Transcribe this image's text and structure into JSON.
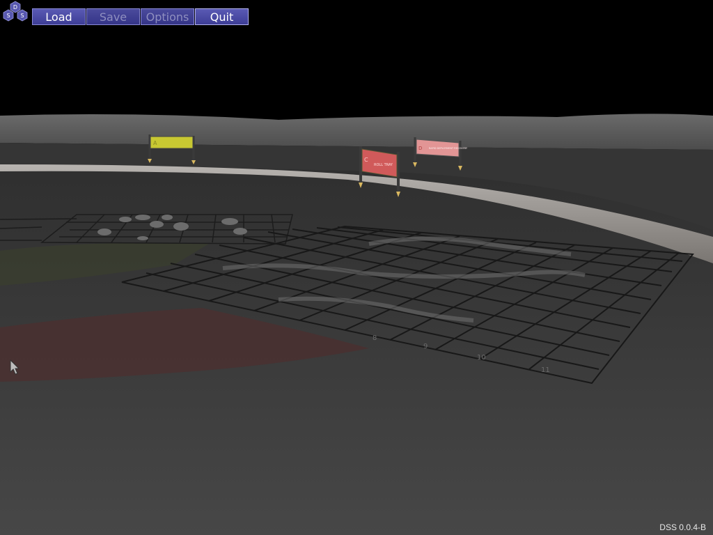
{
  "logo": {
    "letters": [
      "D",
      "S",
      "S"
    ]
  },
  "toolbar": {
    "load_label": "Load",
    "save_label": "Save",
    "options_label": "Options",
    "quit_label": "Quit"
  },
  "scene": {
    "signs": [
      {
        "letter": "A",
        "text": ""
      },
      {
        "letter": "C",
        "text": "ROLL TRAY"
      },
      {
        "letter": "D",
        "text": "RAPID DEPLOYMENT RECOVERY"
      }
    ],
    "grid_numbers": [
      "8",
      "9",
      "10",
      "11"
    ]
  },
  "version": "DSS 0.0.4-B",
  "colors": {
    "button_bg": "#4646a4",
    "button_border": "#8a8ad8",
    "sky": "#000000",
    "ground": "#3a3a3a",
    "sign_yellow": "#c8c832",
    "sign_red": "#d05a5a",
    "sign_pink": "#e29595"
  }
}
